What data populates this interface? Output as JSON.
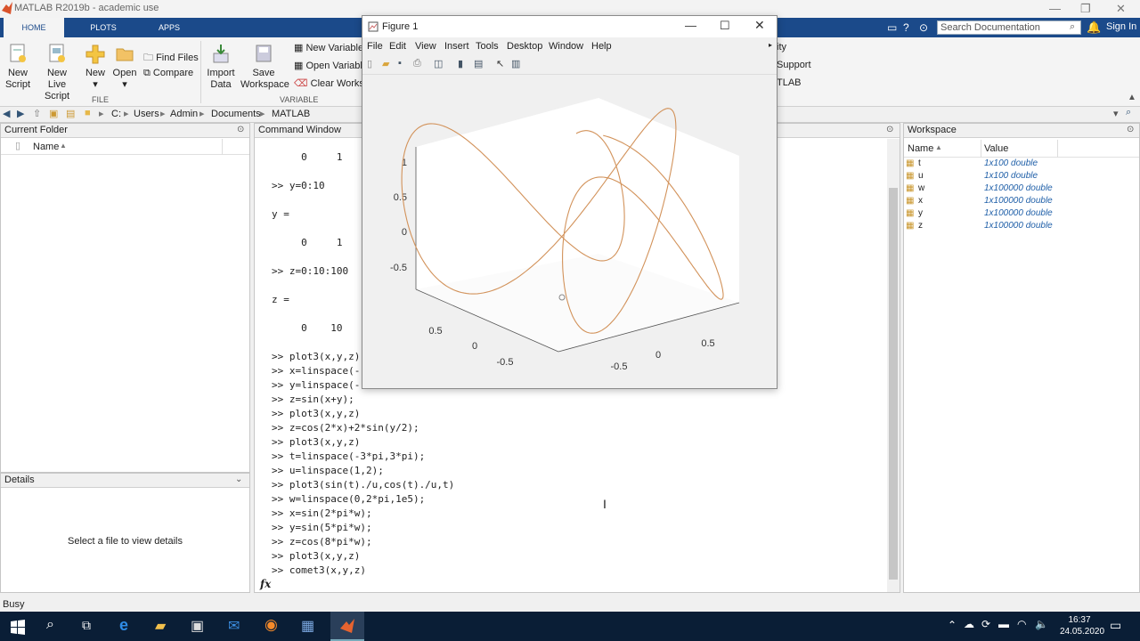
{
  "window": {
    "title": "MATLAB R2019b - academic use"
  },
  "ribbon": {
    "tabs": [
      "HOME",
      "PLOTS",
      "APPS"
    ],
    "file_section": "FILE",
    "variable_section": "VARIABLE",
    "new_script": [
      "New",
      "Script"
    ],
    "new_live_script": [
      "New",
      "Live Script"
    ],
    "new": "New",
    "open": "Open",
    "find_files": "Find Files",
    "compare": "Compare",
    "import_data": [
      "Import",
      "Data"
    ],
    "save_workspace": [
      "Save",
      "Workspace"
    ],
    "new_variable": "New Variable",
    "open_variable": "Open Variable",
    "clear_workspace": "Clear Workspace",
    "right_items": [
      "ity",
      "Support",
      "TLAB"
    ],
    "search_placeholder": "Search Documentation",
    "sign_in": "Sign In"
  },
  "path": [
    "C:",
    "Users",
    "Admin",
    "Documents",
    "MATLAB"
  ],
  "current_folder": {
    "title": "Current Folder",
    "name_col": "Name"
  },
  "details": {
    "title": "Details",
    "empty": "Select a file to view details"
  },
  "command_window": {
    "title": "Command Window",
    "lines": [
      "     0     1",
      "",
      ">> y=0:10",
      "",
      "y =",
      "",
      "     0     1",
      "",
      ">> z=0:10:100",
      "",
      "z =",
      "",
      "     0    10",
      "",
      ">> plot3(x,y,z)",
      ">> x=linspace(-",
      ">> y=linspace(-",
      ">> z=sin(x+y);",
      ">> plot3(x,y,z)",
      ">> z=cos(2*x)+2*sin(y/2);",
      ">> plot3(x,y,z)",
      ">> t=linspace(-3*pi,3*pi);",
      ">> u=linspace(1,2);",
      ">> plot3(sin(t)./u,cos(t)./u,t)",
      ">> w=linspace(0,2*pi,1e5);",
      ">> x=sin(2*pi*w);",
      ">> y=sin(5*pi*w);",
      ">> z=cos(8*pi*w);",
      ">> plot3(x,y,z)",
      ">> comet3(x,y,z)"
    ],
    "prompt_icon": "fx"
  },
  "workspace": {
    "title": "Workspace",
    "columns": [
      "Name",
      "Value"
    ],
    "rows": [
      {
        "name": "t",
        "value": "1x100 double"
      },
      {
        "name": "u",
        "value": "1x100 double"
      },
      {
        "name": "w",
        "value": "1x100000 double"
      },
      {
        "name": "x",
        "value": "1x100000 double"
      },
      {
        "name": "y",
        "value": "1x100000 double"
      },
      {
        "name": "z",
        "value": "1x100000 double"
      }
    ]
  },
  "figure": {
    "title": "Figure 1",
    "menu": [
      "File",
      "Edit",
      "View",
      "Insert",
      "Tools",
      "Desktop",
      "Window",
      "Help"
    ],
    "z_ticks": [
      "1",
      "0.5",
      "0",
      "-0.5"
    ],
    "x_ticks": [
      "0.5",
      "0",
      "-0.5"
    ],
    "y_ticks": [
      "-0.5",
      "0",
      "0.5"
    ],
    "line_color": "#d2925a"
  },
  "status": {
    "text": "Busy"
  },
  "taskbar": {
    "time": "16:37",
    "date": "24.05.2020"
  }
}
